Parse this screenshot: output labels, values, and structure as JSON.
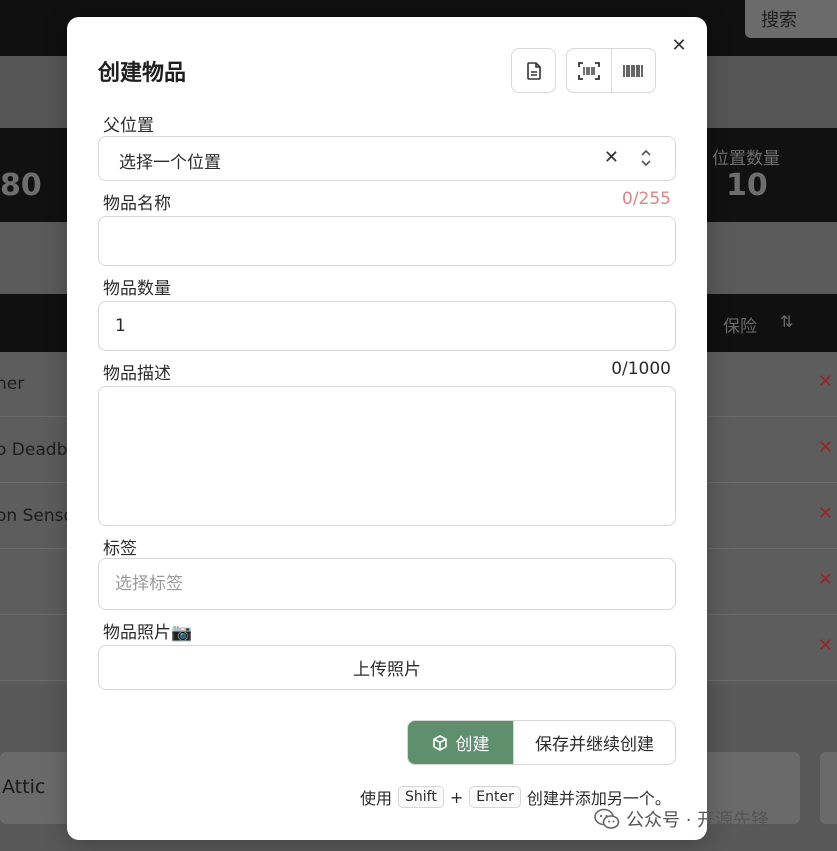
{
  "background": {
    "search_label": "搜索",
    "stat_left_value": "80",
    "stat_right_label": "位置数量",
    "stat_right_value": "10",
    "table_col_insurance": "保险",
    "table_sort_icon": "⇅",
    "rows": [
      "ner",
      "o Deadbo",
      "on Senso",
      "",
      ""
    ],
    "card_text": "Attic"
  },
  "modal": {
    "title": "创建物品",
    "close_icon": "✕",
    "toolbar": {
      "doc_icon": "document-icon",
      "scan_icon": "barcode-scan-icon",
      "barcode_icon": "barcode-icon"
    },
    "parent_location": {
      "label": "父位置",
      "value": "选择一个位置",
      "clear_icon": "✕"
    },
    "item_name": {
      "label": "物品名称",
      "counter": "0/255",
      "value": ""
    },
    "item_quantity": {
      "label": "物品数量",
      "value": "1"
    },
    "item_description": {
      "label": "物品描述",
      "counter": "0/1000",
      "value": ""
    },
    "tags": {
      "label": "标签",
      "placeholder": "选择标签"
    },
    "photo": {
      "label": "物品照片📷",
      "upload_label": "上传照片"
    },
    "actions": {
      "create_label": "创建",
      "save_continue_label": "保存并继续创建"
    },
    "hint": {
      "prefix": "使用",
      "key1": "Shift",
      "plus": "+",
      "key2": "Enter",
      "suffix": "创建并添加另一个。"
    }
  },
  "watermark": {
    "text": "公众号 · 开源先锋"
  },
  "colors": {
    "accent": "#5f8f6d",
    "counter_warn": "#d98585"
  }
}
